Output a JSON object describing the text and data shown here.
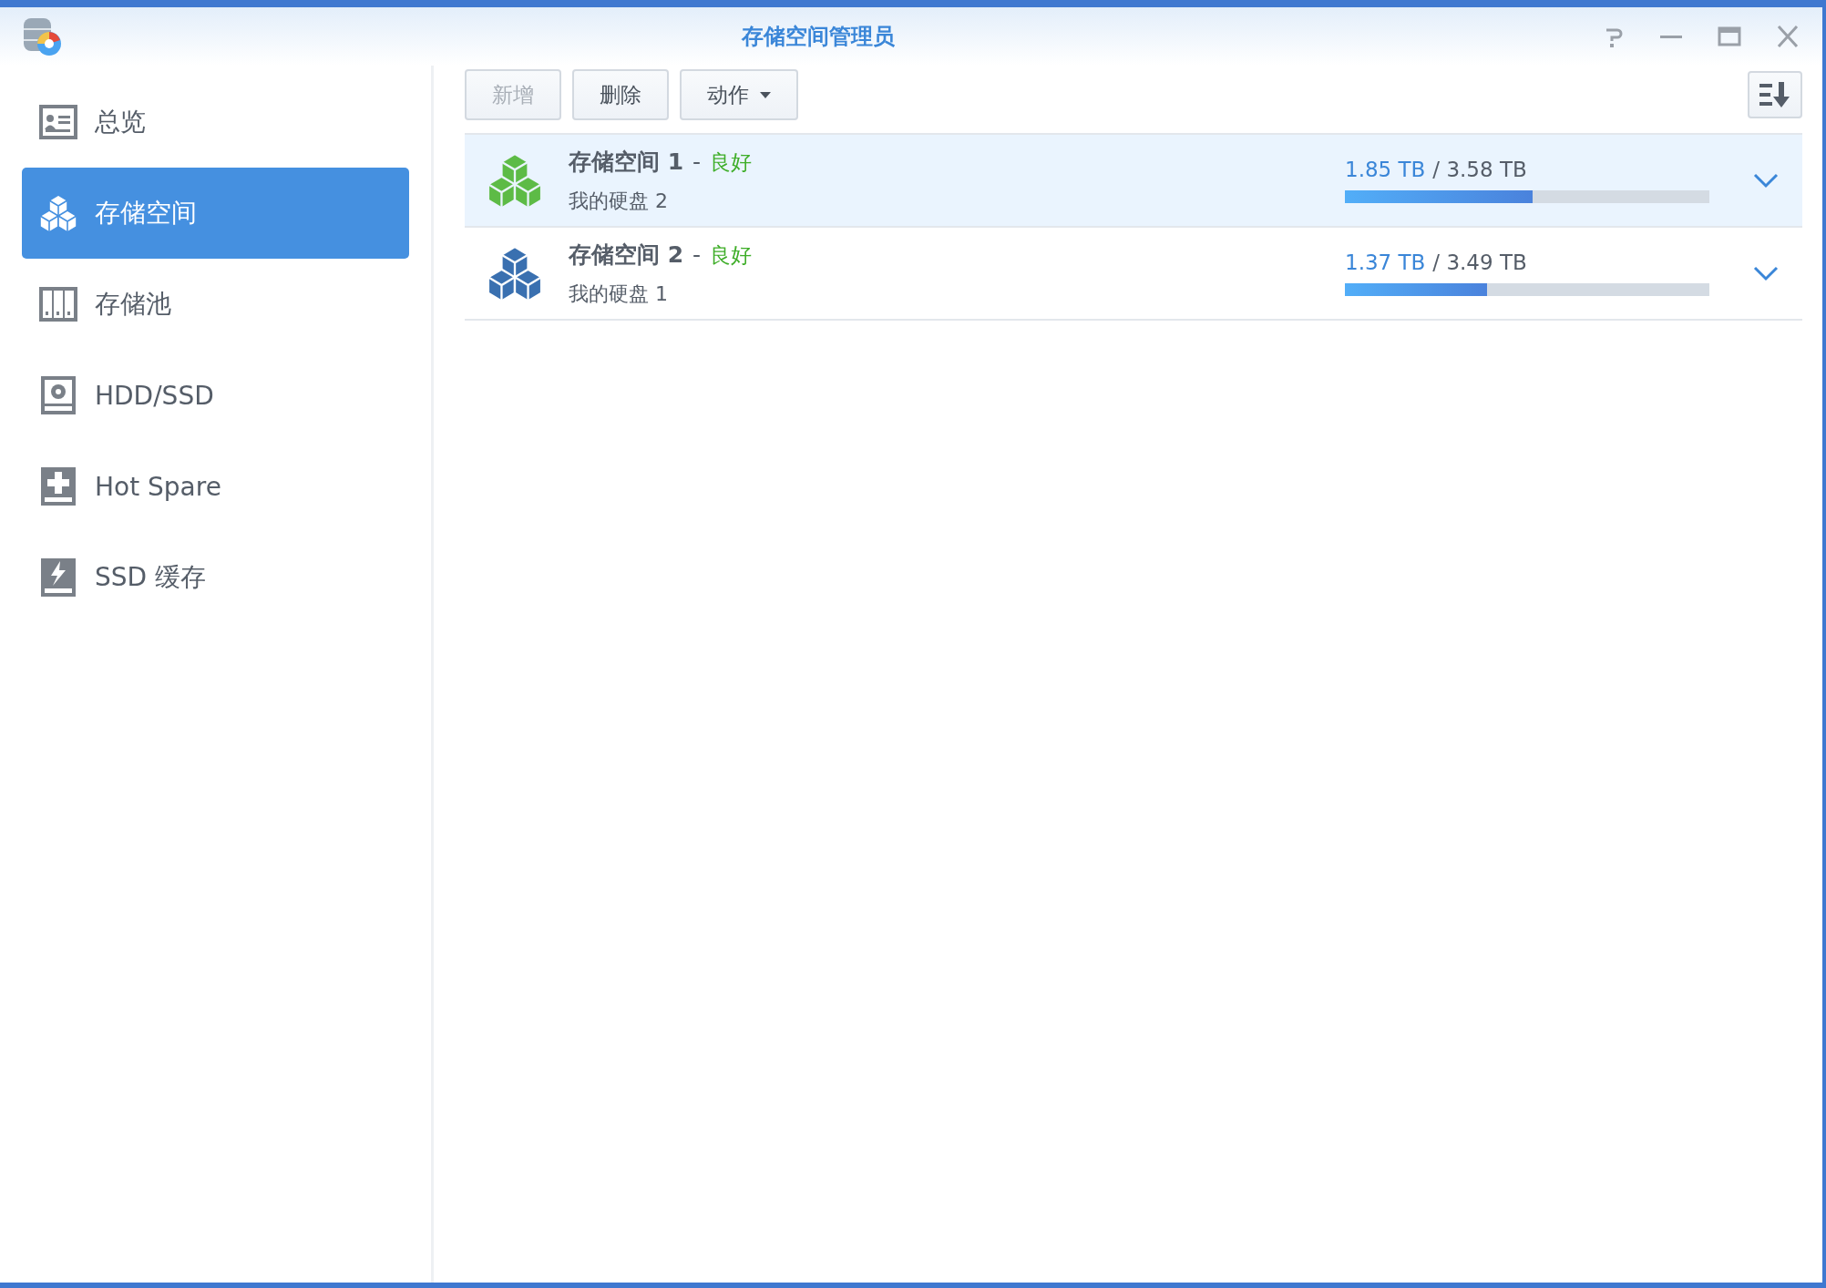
{
  "window": {
    "title": "存储空间管理员"
  },
  "sidebar": {
    "items": [
      {
        "label": "总览",
        "kind": "overview",
        "selected": false
      },
      {
        "label": "存储空间",
        "kind": "volume",
        "selected": true
      },
      {
        "label": "存储池",
        "kind": "pool",
        "selected": false
      },
      {
        "label": "HDD/SSD",
        "kind": "disk",
        "selected": false
      },
      {
        "label": "Hot Spare",
        "kind": "spare",
        "selected": false
      },
      {
        "label": "SSD 缓存",
        "kind": "cache",
        "selected": false
      }
    ]
  },
  "toolbar": {
    "buttons": [
      {
        "label": "新增",
        "disabled": true,
        "dropdown": false
      },
      {
        "label": "删除",
        "disabled": false,
        "dropdown": false
      },
      {
        "label": "动作",
        "disabled": false,
        "dropdown": true
      }
    ]
  },
  "volumes": [
    {
      "name": "存储空间 1",
      "separator": "-",
      "status": "良好",
      "description": "我的硬盘 2",
      "used": "1.85 TB",
      "total": "/ 3.58 TB",
      "level": 0.514,
      "color": "#5dbb46",
      "selected": true
    },
    {
      "name": "存储空间 2",
      "separator": "-",
      "status": "良好",
      "description": "我的硬盘 1",
      "used": "1.37 TB",
      "total": "/ 3.49 TB",
      "level": 0.39,
      "color": "#3a70b0",
      "selected": false
    }
  ]
}
